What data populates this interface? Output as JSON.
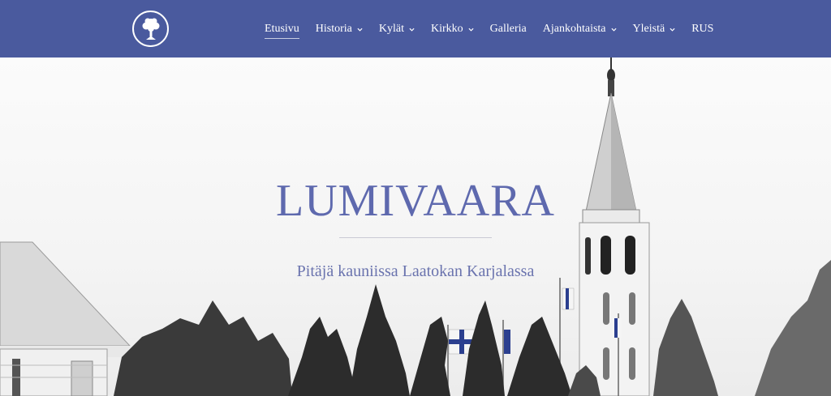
{
  "header": {
    "logo_icon": "tree-emblem-icon",
    "nav": [
      {
        "label": "Etusivu",
        "dropdown": false,
        "active": true
      },
      {
        "label": "Historia",
        "dropdown": true,
        "active": false
      },
      {
        "label": "Kylät",
        "dropdown": true,
        "active": false
      },
      {
        "label": "Kirkko",
        "dropdown": true,
        "active": false
      },
      {
        "label": "Galleria",
        "dropdown": false,
        "active": false
      },
      {
        "label": "Ajankohtaista",
        "dropdown": true,
        "active": false
      },
      {
        "label": "Yleistä",
        "dropdown": true,
        "active": false
      },
      {
        "label": "RUS",
        "dropdown": false,
        "active": false
      }
    ],
    "colors": {
      "background": "#4a5a9e",
      "text": "#ffffff"
    }
  },
  "hero": {
    "title": "LUMIVAARA",
    "subtitle": "Pitäjä kauniissa Laatokan Karjalassa",
    "background_image": "church-with-flags-black-and-white-photo",
    "colors": {
      "title": "#5e69ae",
      "subtitle": "#6a73ae"
    }
  }
}
